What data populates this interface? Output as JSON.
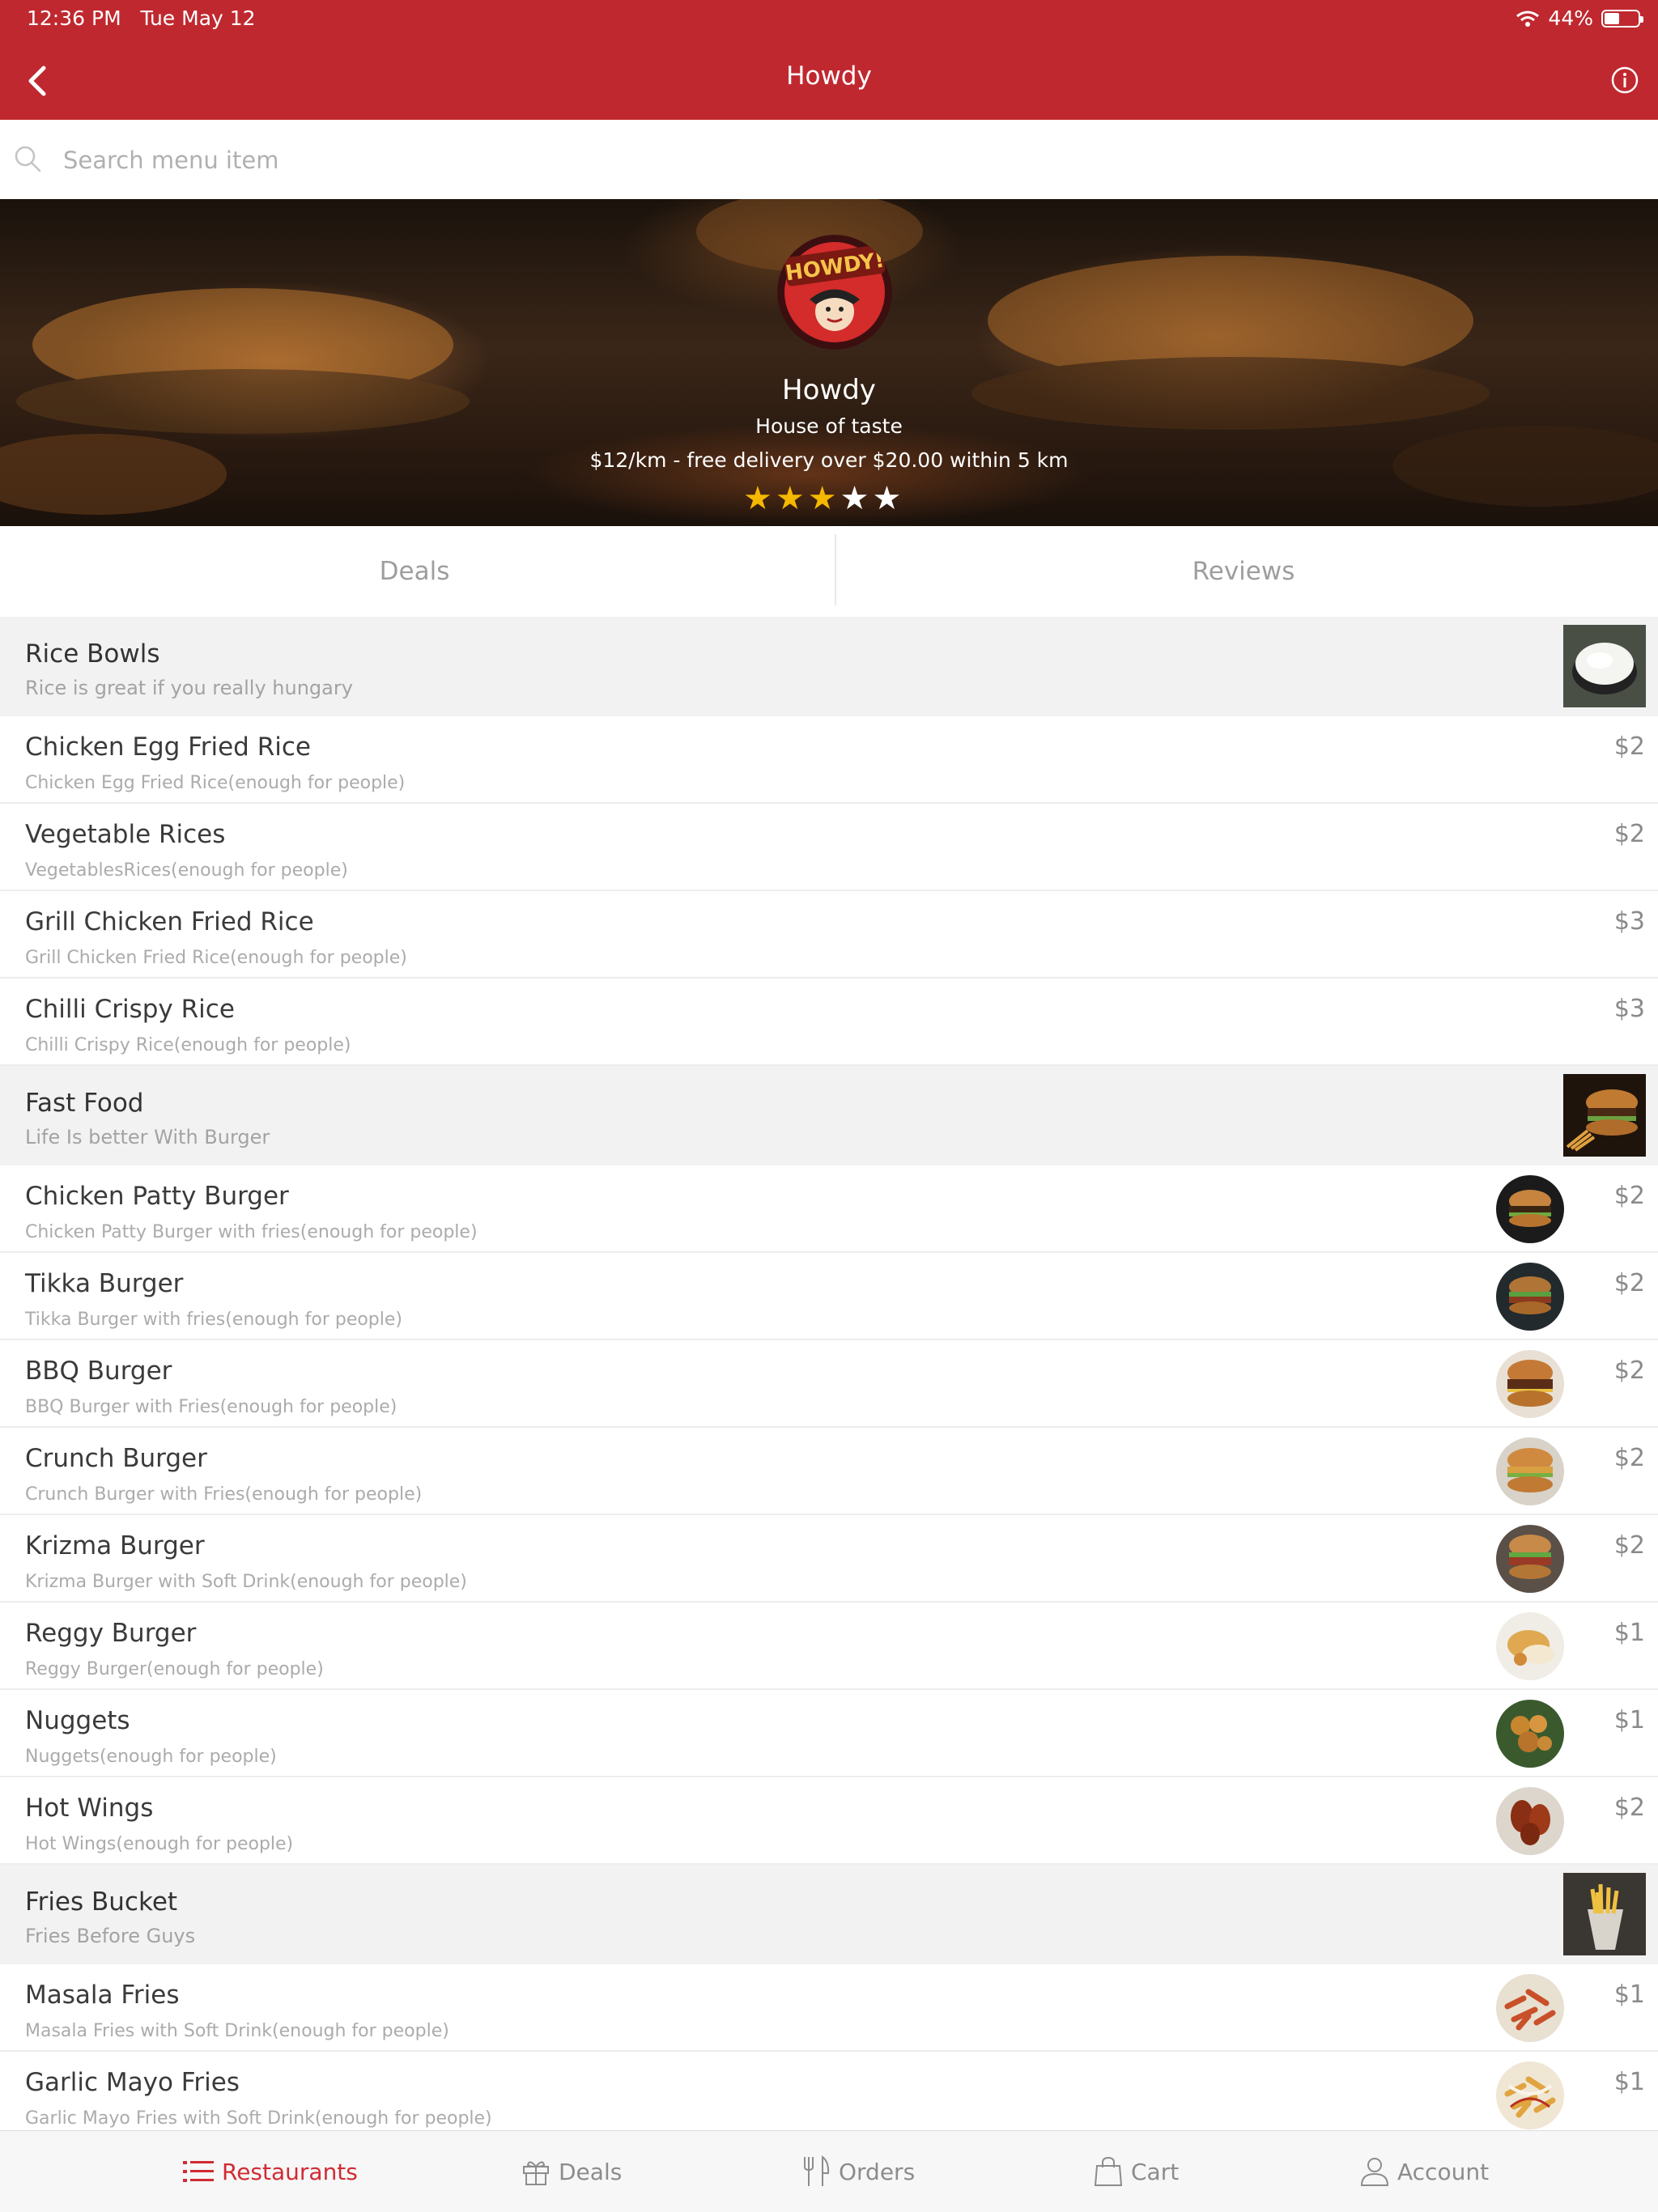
{
  "status_bar": {
    "time": "12:36 PM",
    "date": "Tue May 12",
    "battery": "44%",
    "battery_level": 0.44
  },
  "nav": {
    "title": "Howdy"
  },
  "search": {
    "placeholder": "Search menu item"
  },
  "restaurant": {
    "logo_text": "HOWDY!",
    "name": "Howdy",
    "tagline": "House of taste",
    "delivery": "$12/km - free delivery over $20.00 within 5 km",
    "rating": 3,
    "rating_max": 5
  },
  "tabs": [
    {
      "label": "Deals"
    },
    {
      "label": "Reviews"
    }
  ],
  "menu": {
    "rice": {
      "title": "Rice Bowls",
      "subtitle": "Rice is great if you really hungary",
      "items": [
        {
          "name": "Chicken Egg Fried Rice",
          "desc": "Chicken Egg Fried Rice(enough for  people)",
          "price": "$2"
        },
        {
          "name": "Vegetable Rices",
          "desc": "VegetablesRices(enough for  people)",
          "price": "$2"
        },
        {
          "name": "Grill Chicken Fried Rice",
          "desc": "Grill Chicken Fried Rice(enough for  people)",
          "price": "$3"
        },
        {
          "name": "Chilli Crispy Rice",
          "desc": "Chilli Crispy Rice(enough for  people)",
          "price": "$3"
        }
      ]
    },
    "fast": {
      "title": "Fast Food",
      "subtitle": "Life Is better With Burger",
      "items": [
        {
          "name": "Chicken Patty Burger",
          "desc": "Chicken Patty Burger  with fries(enough for  people)",
          "price": "$2"
        },
        {
          "name": "Tikka Burger",
          "desc": "Tikka Burger with fries(enough for  people)",
          "price": "$2"
        },
        {
          "name": "BBQ Burger",
          "desc": "BBQ Burger with Fries(enough for  people)",
          "price": "$2"
        },
        {
          "name": "Crunch Burger",
          "desc": "Crunch Burger with Fries(enough for  people)",
          "price": "$2"
        },
        {
          "name": "Krizma Burger",
          "desc": "Krizma Burger with Soft Drink(enough for  people)",
          "price": "$2"
        },
        {
          "name": "Reggy Burger",
          "desc": "Reggy Burger(enough for  people)",
          "price": "$1"
        },
        {
          "name": "Nuggets",
          "desc": "Nuggets(enough for  people)",
          "price": "$1"
        },
        {
          "name": "Hot Wings",
          "desc": "Hot Wings(enough for  people)",
          "price": "$2"
        }
      ]
    },
    "fries": {
      "title": "Fries Bucket",
      "subtitle": "Fries Before Guys",
      "items": [
        {
          "name": "Masala Fries",
          "desc": "Masala Fries with Soft Drink(enough for  people)",
          "price": "$1"
        },
        {
          "name": "Garlic Mayo Fries",
          "desc": "Garlic Mayo Fries with Soft Drink(enough for  people)",
          "price": "$1"
        }
      ]
    }
  },
  "bottom_nav": [
    {
      "label": "Restaurants",
      "icon": "list-icon",
      "active": true
    },
    {
      "label": "Deals",
      "icon": "gift-icon",
      "active": false
    },
    {
      "label": "Orders",
      "icon": "utensils-icon",
      "active": false
    },
    {
      "label": "Cart",
      "icon": "bag-icon",
      "active": false
    },
    {
      "label": "Account",
      "icon": "person-icon",
      "active": false
    }
  ],
  "colors": {
    "brand": "#c0282f",
    "active_tab": "#d12b33",
    "star": "#f5b800"
  }
}
